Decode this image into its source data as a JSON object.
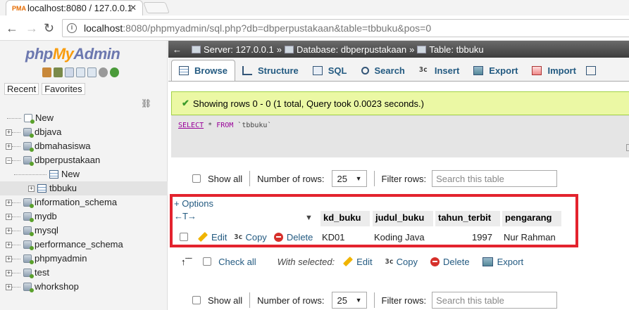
{
  "browser": {
    "tab_title": "localhost:8080 / 127.0.0.1",
    "tab_logo": "PMA",
    "url_host": "localhost",
    "url_path": ":8080/phpmyadmin/sql.php?db=dbperpustakaan&table=tbbuku&pos=0"
  },
  "sidebar": {
    "logo": {
      "php": "php",
      "my": "My",
      "admin": "Admin"
    },
    "recent_label": "Recent",
    "favorites_label": "Favorites",
    "tree": [
      {
        "label": "New",
        "type": "new"
      },
      {
        "label": "dbjava",
        "type": "db"
      },
      {
        "label": "dbmahasiswa",
        "type": "db"
      },
      {
        "label": "dbperpustakaan",
        "type": "db-open"
      },
      {
        "label": "New",
        "type": "child-new"
      },
      {
        "label": "tbbuku",
        "type": "child-table"
      },
      {
        "label": "information_schema",
        "type": "db"
      },
      {
        "label": "mydb",
        "type": "db"
      },
      {
        "label": "mysql",
        "type": "db"
      },
      {
        "label": "performance_schema",
        "type": "db"
      },
      {
        "label": "phpmyadmin",
        "type": "db"
      },
      {
        "label": "test",
        "type": "db"
      },
      {
        "label": "whorkshop",
        "type": "db"
      }
    ]
  },
  "breadcrumb": {
    "server": "Server: 127.0.0.1",
    "database": "Database: dbperpustakaan",
    "table": "Table: tbbuku"
  },
  "tabs": [
    {
      "label": "Browse",
      "icon": "browse-icon",
      "active": true
    },
    {
      "label": "Structure",
      "icon": "structure-icon"
    },
    {
      "label": "SQL",
      "icon": "sql-icon"
    },
    {
      "label": "Search",
      "icon": "search-icon"
    },
    {
      "label": "Insert",
      "icon": "insert-icon"
    },
    {
      "label": "Export",
      "icon": "export-icon"
    },
    {
      "label": "Import",
      "icon": "import-icon"
    }
  ],
  "message": "Showing rows 0 - 0 (1 total, Query took 0.0023 seconds.)",
  "sql": {
    "keyword1": "SELECT",
    "rest1": " * ",
    "keyword2": "FROM",
    "rest2": " `tbbuku`"
  },
  "nav": {
    "show_all": "Show all",
    "num_rows_label": "Number of rows:",
    "num_rows_value": "25",
    "filter_label": "Filter rows:",
    "filter_placeholder": "Search this table"
  },
  "results": {
    "options_label": "+ Options",
    "columns": [
      "kd_buku",
      "judul_buku",
      "tahun_terbit",
      "pengarang"
    ],
    "row": {
      "edit": "Edit",
      "copy": "Copy",
      "delete": "Delete",
      "values": [
        "KD01",
        "Koding Java",
        "1997",
        "Nur Rahman"
      ]
    }
  },
  "with_selected": {
    "check_all": "Check all",
    "label": "With selected:",
    "edit": "Edit",
    "copy": "Copy",
    "delete": "Delete",
    "export": "Export"
  },
  "colors": {
    "accent": "#235a81",
    "highlight": "#e3232e",
    "success_bg": "#ebf8a4"
  }
}
